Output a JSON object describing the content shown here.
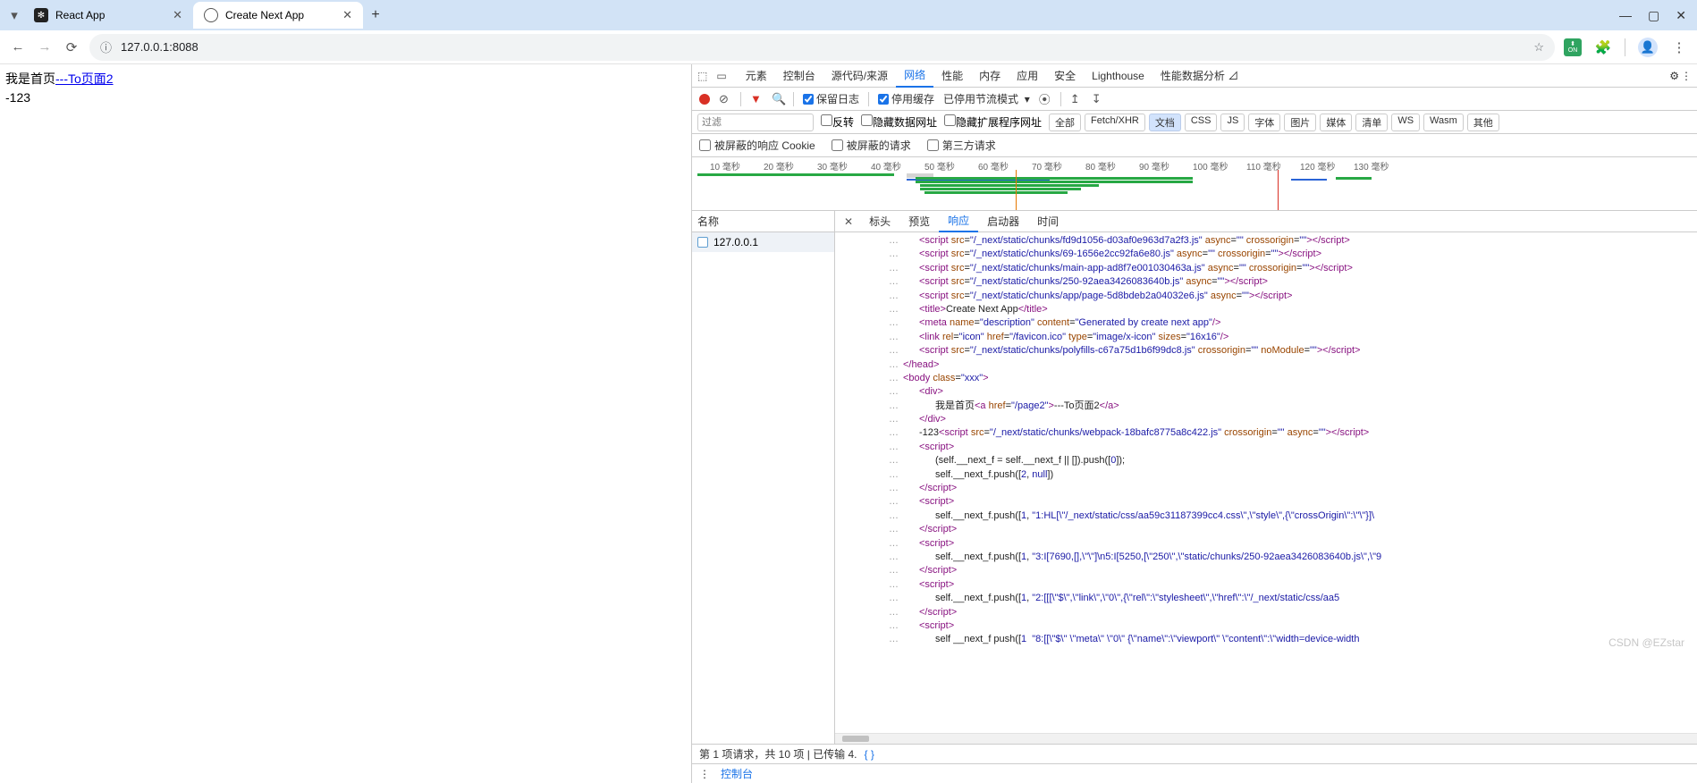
{
  "browser": {
    "tabs": [
      {
        "title": "React App",
        "active": false
      },
      {
        "title": "Create Next App",
        "active": true
      }
    ],
    "url": "127.0.0.1:8088",
    "ext_label": "ON",
    "window_buttons": [
      "—",
      "▢",
      "✕"
    ]
  },
  "page": {
    "line1_prefix": "我是首页",
    "line1_link": "---To页面2",
    "line2": "-123"
  },
  "devtools": {
    "main_tabs": [
      "元素",
      "控制台",
      "源代码/来源",
      "网络",
      "性能",
      "内存",
      "应用",
      "安全",
      "Lighthouse",
      "性能数据分析 ⊿"
    ],
    "main_active": "网络",
    "toolbar": {
      "preserve_log": "保留日志",
      "disable_cache": "停用缓存",
      "throttle": "已停用节流模式"
    },
    "filter": {
      "placeholder": "过滤",
      "invert": "反转",
      "hide_data": "隐藏数据网址",
      "hide_ext": "隐藏扩展程序网址",
      "chips": [
        "全部",
        "Fetch/XHR",
        "文档",
        "CSS",
        "JS",
        "字体",
        "图片",
        "媒体",
        "清单",
        "WS",
        "Wasm",
        "其他"
      ],
      "chip_active": "文档"
    },
    "cookie_row": {
      "blocked_cookies": "被屏蔽的响应 Cookie",
      "blocked_req": "被屏蔽的请求",
      "third_party": "第三方请求"
    },
    "timeline_ticks": [
      "10 毫秒",
      "20 毫秒",
      "30 毫秒",
      "40 毫秒",
      "50 毫秒",
      "60 毫秒",
      "70 毫秒",
      "80 毫秒",
      "90 毫秒",
      "100 毫秒",
      "110 毫秒",
      "120 毫秒",
      "130 毫秒"
    ],
    "request_list": {
      "header": "名称",
      "items": [
        "127.0.0.1"
      ]
    },
    "response_tabs": [
      "标头",
      "预览",
      "响应",
      "启动器",
      "时间"
    ],
    "response_active": "响应",
    "status_bar": "第 1 项请求，共 10 项  |  已传输 4.",
    "drawer_tab": "控制台",
    "watermark": "CSDN @EZstar"
  },
  "code_lines": [
    {
      "indent": 3,
      "html": "<span class='tag'>&lt;script</span> <span class='attr'>src</span>=<span class='val'>\"/_next/static/chunks/fd9d1056-d03af0e963d7a2f3.js\"</span> <span class='attr'>async</span>=<span class='val'>\"\"</span> <span class='attr'>crossorigin</span>=<span class='val'>\"\"</span><span class='tag'>&gt;&lt;/script&gt;</span>"
    },
    {
      "indent": 3,
      "html": "<span class='tag'>&lt;script</span> <span class='attr'>src</span>=<span class='val'>\"/_next/static/chunks/69-1656e2cc92fa6e80.js\"</span> <span class='attr'>async</span>=<span class='val'>\"\"</span> <span class='attr'>crossorigin</span>=<span class='val'>\"\"</span><span class='tag'>&gt;&lt;/script&gt;</span>"
    },
    {
      "indent": 3,
      "html": "<span class='tag'>&lt;script</span> <span class='attr'>src</span>=<span class='val'>\"/_next/static/chunks/main-app-ad8f7e001030463a.js\"</span> <span class='attr'>async</span>=<span class='val'>\"\"</span> <span class='attr'>crossorigin</span>=<span class='val'>\"\"</span><span class='tag'>&gt;&lt;/script&gt;</span>"
    },
    {
      "indent": 3,
      "html": "<span class='tag'>&lt;script</span> <span class='attr'>src</span>=<span class='val'>\"/_next/static/chunks/250-92aea3426083640b.js\"</span> <span class='attr'>async</span>=<span class='val'>\"\"</span><span class='tag'>&gt;&lt;/script&gt;</span>"
    },
    {
      "indent": 3,
      "html": "<span class='tag'>&lt;script</span> <span class='attr'>src</span>=<span class='val'>\"/_next/static/chunks/app/page-5d8bdeb2a04032e6.js\"</span> <span class='attr'>async</span>=<span class='val'>\"\"</span><span class='tag'>&gt;&lt;/script&gt;</span>"
    },
    {
      "indent": 3,
      "html": "<span class='tag'>&lt;title&gt;</span><span class='txt'>Create Next App</span><span class='tag'>&lt;/title&gt;</span>"
    },
    {
      "indent": 3,
      "html": "<span class='tag'>&lt;meta</span> <span class='attr'>name</span>=<span class='val'>\"description\"</span> <span class='attr'>content</span>=<span class='val'>\"Generated by create next app\"</span><span class='tag'>/&gt;</span>"
    },
    {
      "indent": 3,
      "html": "<span class='tag'>&lt;link</span> <span class='attr'>rel</span>=<span class='val'>\"icon\"</span> <span class='attr'>href</span>=<span class='val'>\"/favicon.ico\"</span> <span class='attr'>type</span>=<span class='val'>\"image/x-icon\"</span> <span class='attr'>sizes</span>=<span class='val'>\"16x16\"</span><span class='tag'>/&gt;</span>"
    },
    {
      "indent": 3,
      "html": "<span class='tag'>&lt;script</span> <span class='attr'>src</span>=<span class='val'>\"/_next/static/chunks/polyfills-c67a75d1b6f99dc8.js\"</span> <span class='attr'>crossorigin</span>=<span class='val'>\"\"</span> <span class='attr'>noModule</span>=<span class='val'>\"\"</span><span class='tag'>&gt;&lt;/script&gt;</span>"
    },
    {
      "indent": 2,
      "html": "<span class='tag'>&lt;/head&gt;</span>"
    },
    {
      "indent": 2,
      "html": "<span class='tag'>&lt;body</span> <span class='attr'>class</span>=<span class='val'>\"xxx\"</span><span class='tag'>&gt;</span>"
    },
    {
      "indent": 3,
      "html": "<span class='tag'>&lt;div&gt;</span>"
    },
    {
      "indent": 4,
      "html": "<span class='txt'>我是首页</span><span class='tag'>&lt;a</span> <span class='attr'>href</span>=<span class='val'>\"/page2\"</span><span class='tag'>&gt;</span><span class='txt'>---To页面2</span><span class='tag'>&lt;/a&gt;</span>"
    },
    {
      "indent": 3,
      "html": "<span class='tag'>&lt;/div&gt;</span>"
    },
    {
      "indent": 3,
      "html": "<span class='txt'>-123</span><span class='tag'>&lt;script</span> <span class='attr'>src</span>=<span class='val'>\"/_next/static/chunks/webpack-18bafc8775a8c422.js\"</span> <span class='attr'>crossorigin</span>=<span class='val'>\"\"</span> <span class='attr'>async</span>=<span class='val'>\"\"</span><span class='tag'>&gt;&lt;/script&gt;</span>"
    },
    {
      "indent": 3,
      "html": "<span class='tag'>&lt;script&gt;</span>"
    },
    {
      "indent": 4,
      "html": "<span class='kw'>(self.__next_f = self.__next_f || []).push([</span><span class='num'>0</span><span class='kw'>]);</span>"
    },
    {
      "indent": 4,
      "html": "<span class='kw'>self.__next_f.push([</span><span class='num'>2</span><span class='kw'>, </span><span class='num'>null</span><span class='kw'>])</span>"
    },
    {
      "indent": 3,
      "html": "<span class='tag'>&lt;/script&gt;</span>"
    },
    {
      "indent": 3,
      "html": "<span class='tag'>&lt;script&gt;</span>"
    },
    {
      "indent": 4,
      "html": "<span class='kw'>self.__next_f.push([</span><span class='num'>1</span><span class='kw'>, </span><span class='val'>\"1:HL[\\\"/_next/static/css/aa59c31187399cc4.css\\\",\\\"style\\\",{\\\"crossOrigin\\\":\\\"\\\"}]\\</span>"
    },
    {
      "indent": 3,
      "html": "<span class='tag'>&lt;/script&gt;</span>"
    },
    {
      "indent": 3,
      "html": "<span class='tag'>&lt;script&gt;</span>"
    },
    {
      "indent": 4,
      "html": "<span class='kw'>self.__next_f.push([</span><span class='num'>1</span><span class='kw'>, </span><span class='val'>\"3:I[7690,[],\\\"\\\"]\\n5:I[5250,[\\\"250\\\",\\\"static/chunks/250-92aea3426083640b.js\\\",\\\"9</span>"
    },
    {
      "indent": 3,
      "html": "<span class='tag'>&lt;/script&gt;</span>"
    },
    {
      "indent": 3,
      "html": "<span class='tag'>&lt;script&gt;</span>"
    },
    {
      "indent": 4,
      "html": "<span class='kw'>self.__next_f.push([</span><span class='num'>1</span><span class='kw'>, </span><span class='val'>\"2:[[[\\\"$\\\",\\\"link\\\",\\\"0\\\",{\\\"rel\\\":\\\"stylesheet\\\",\\\"href\\\":\\\"/_next/static/css/aa5</span>"
    },
    {
      "indent": 3,
      "html": "<span class='tag'>&lt;/script&gt;</span>"
    },
    {
      "indent": 3,
      "html": "<span class='tag'>&lt;script&gt;</span>"
    },
    {
      "indent": 4,
      "html": "<span class='kw'>self __next_f push([</span><span class='num'>1</span><span class='kw'>  </span><span class='val'>\"8:[[\\\"$\\\" \\\"meta\\\" \\\"0\\\" {\\\"name\\\":\\\"viewport\\\" \\\"content\\\":\\\"width=device-width</span>"
    }
  ]
}
